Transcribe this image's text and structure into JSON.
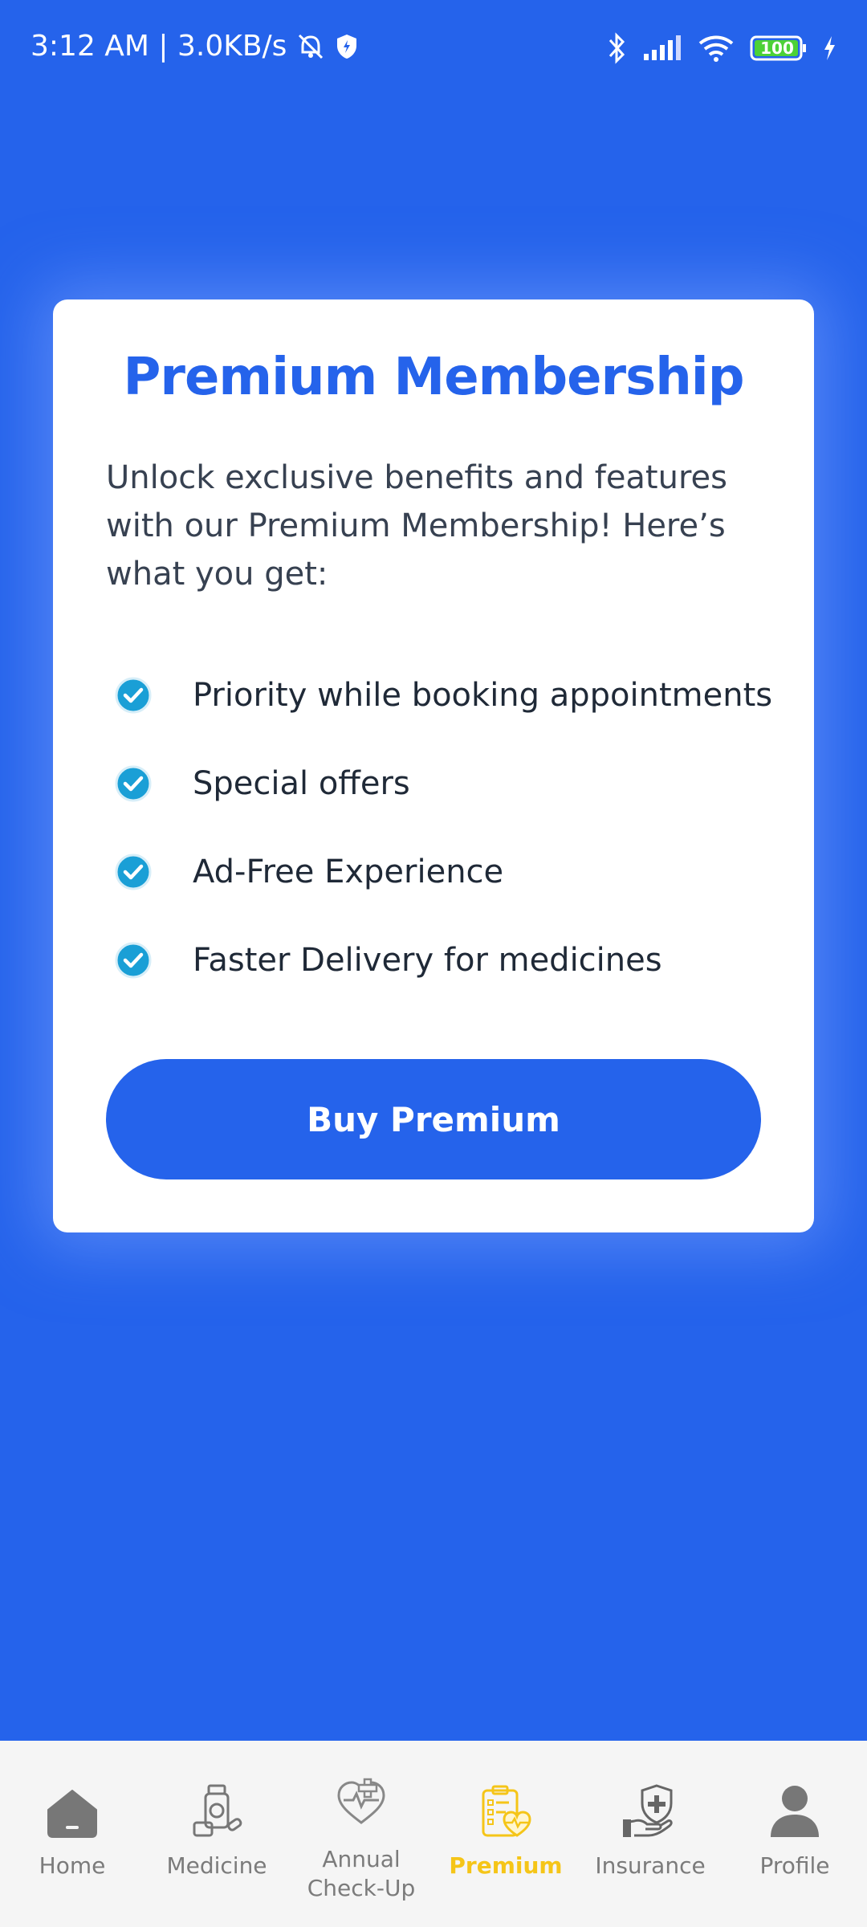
{
  "status_bar": {
    "time_speed": "3:12 AM | 3.0KB/s",
    "battery": "100"
  },
  "card": {
    "title": "Premium Membership",
    "description": "Unlock exclusive benefits and features with our Premium Membership! Here’s what you get:",
    "features": [
      "Priority while booking appointments",
      "Special offers",
      "Ad-Free Experience",
      "Faster Delivery for medicines"
    ],
    "button_label": "Buy Premium"
  },
  "nav": {
    "items": [
      {
        "label": "Home",
        "icon": "home-icon"
      },
      {
        "label": "Medicine",
        "icon": "medicine-icon"
      },
      {
        "label": "Annual\nCheck-Up",
        "icon": "checkup-icon"
      },
      {
        "label": "Premium",
        "icon": "premium-icon"
      },
      {
        "label": "Insurance",
        "icon": "insurance-icon"
      },
      {
        "label": "Profile",
        "icon": "profile-icon"
      }
    ],
    "active": "Premium"
  },
  "colors": {
    "primary": "#2563eb",
    "active_nav": "#f5c518",
    "check": "#1a9fd6"
  }
}
